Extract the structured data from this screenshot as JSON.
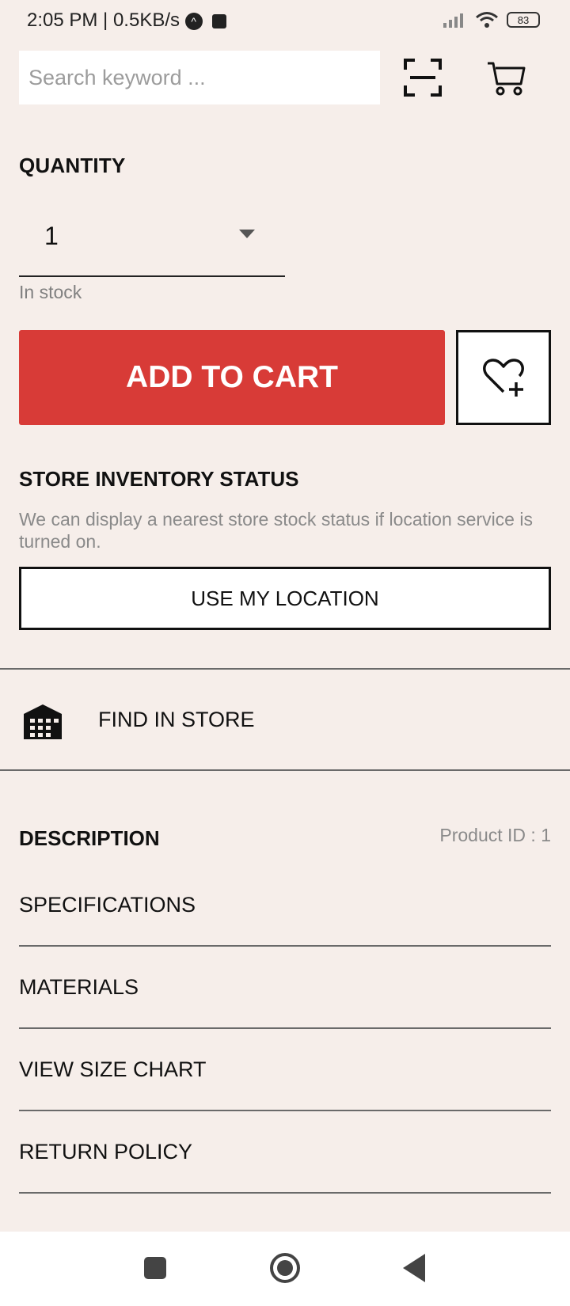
{
  "status_bar": {
    "time": "2:05 PM | 0.5KB/s",
    "battery": "83"
  },
  "header": {
    "search_placeholder": "Search keyword ..."
  },
  "quantity": {
    "title": "QUANTITY",
    "value": "1",
    "stock": "In stock"
  },
  "actions": {
    "add_to_cart": "ADD TO CART"
  },
  "inventory": {
    "title": "STORE INVENTORY STATUS",
    "description": "We can display a nearest store stock status if location service is turned on.",
    "location_button": "USE MY LOCATION"
  },
  "find_in_store": {
    "label": "FIND IN STORE"
  },
  "description": {
    "title": "DESCRIPTION",
    "product_id": "Product ID : 1",
    "items": [
      {
        "label": "SPECIFICATIONS"
      },
      {
        "label": "MATERIALS"
      },
      {
        "label": "VIEW SIZE CHART"
      },
      {
        "label": "RETURN POLICY"
      }
    ]
  },
  "colors": {
    "accent": "#d83b37",
    "background": "#f6eeea"
  }
}
